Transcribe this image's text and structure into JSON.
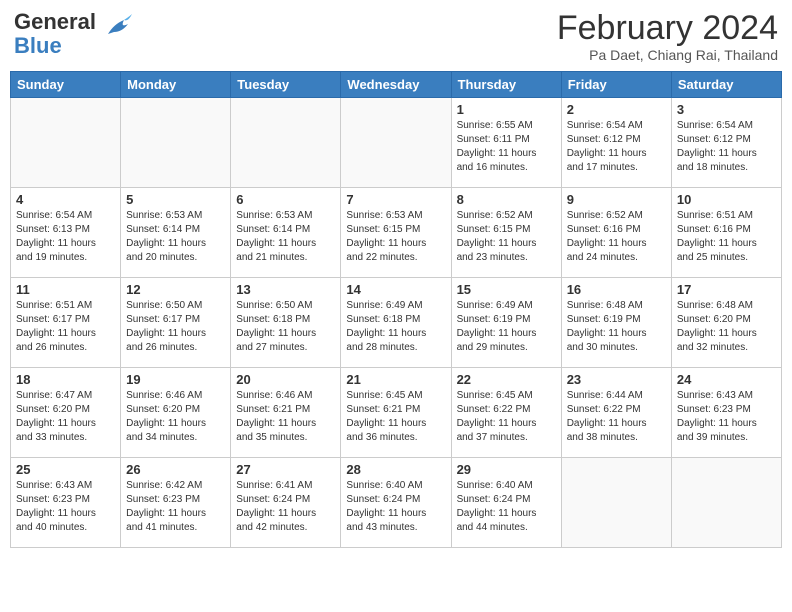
{
  "header": {
    "logo_line1": "General",
    "logo_line2": "Blue",
    "title": "February 2024",
    "subtitle": "Pa Daet, Chiang Rai, Thailand"
  },
  "days_of_week": [
    "Sunday",
    "Monday",
    "Tuesday",
    "Wednesday",
    "Thursday",
    "Friday",
    "Saturday"
  ],
  "weeks": [
    [
      {
        "day": "",
        "info": ""
      },
      {
        "day": "",
        "info": ""
      },
      {
        "day": "",
        "info": ""
      },
      {
        "day": "",
        "info": ""
      },
      {
        "day": "1",
        "info": "Sunrise: 6:55 AM\nSunset: 6:11 PM\nDaylight: 11 hours and 16 minutes."
      },
      {
        "day": "2",
        "info": "Sunrise: 6:54 AM\nSunset: 6:12 PM\nDaylight: 11 hours and 17 minutes."
      },
      {
        "day": "3",
        "info": "Sunrise: 6:54 AM\nSunset: 6:12 PM\nDaylight: 11 hours and 18 minutes."
      }
    ],
    [
      {
        "day": "4",
        "info": "Sunrise: 6:54 AM\nSunset: 6:13 PM\nDaylight: 11 hours and 19 minutes."
      },
      {
        "day": "5",
        "info": "Sunrise: 6:53 AM\nSunset: 6:14 PM\nDaylight: 11 hours and 20 minutes."
      },
      {
        "day": "6",
        "info": "Sunrise: 6:53 AM\nSunset: 6:14 PM\nDaylight: 11 hours and 21 minutes."
      },
      {
        "day": "7",
        "info": "Sunrise: 6:53 AM\nSunset: 6:15 PM\nDaylight: 11 hours and 22 minutes."
      },
      {
        "day": "8",
        "info": "Sunrise: 6:52 AM\nSunset: 6:15 PM\nDaylight: 11 hours and 23 minutes."
      },
      {
        "day": "9",
        "info": "Sunrise: 6:52 AM\nSunset: 6:16 PM\nDaylight: 11 hours and 24 minutes."
      },
      {
        "day": "10",
        "info": "Sunrise: 6:51 AM\nSunset: 6:16 PM\nDaylight: 11 hours and 25 minutes."
      }
    ],
    [
      {
        "day": "11",
        "info": "Sunrise: 6:51 AM\nSunset: 6:17 PM\nDaylight: 11 hours and 26 minutes."
      },
      {
        "day": "12",
        "info": "Sunrise: 6:50 AM\nSunset: 6:17 PM\nDaylight: 11 hours and 26 minutes."
      },
      {
        "day": "13",
        "info": "Sunrise: 6:50 AM\nSunset: 6:18 PM\nDaylight: 11 hours and 27 minutes."
      },
      {
        "day": "14",
        "info": "Sunrise: 6:49 AM\nSunset: 6:18 PM\nDaylight: 11 hours and 28 minutes."
      },
      {
        "day": "15",
        "info": "Sunrise: 6:49 AM\nSunset: 6:19 PM\nDaylight: 11 hours and 29 minutes."
      },
      {
        "day": "16",
        "info": "Sunrise: 6:48 AM\nSunset: 6:19 PM\nDaylight: 11 hours and 30 minutes."
      },
      {
        "day": "17",
        "info": "Sunrise: 6:48 AM\nSunset: 6:20 PM\nDaylight: 11 hours and 32 minutes."
      }
    ],
    [
      {
        "day": "18",
        "info": "Sunrise: 6:47 AM\nSunset: 6:20 PM\nDaylight: 11 hours and 33 minutes."
      },
      {
        "day": "19",
        "info": "Sunrise: 6:46 AM\nSunset: 6:20 PM\nDaylight: 11 hours and 34 minutes."
      },
      {
        "day": "20",
        "info": "Sunrise: 6:46 AM\nSunset: 6:21 PM\nDaylight: 11 hours and 35 minutes."
      },
      {
        "day": "21",
        "info": "Sunrise: 6:45 AM\nSunset: 6:21 PM\nDaylight: 11 hours and 36 minutes."
      },
      {
        "day": "22",
        "info": "Sunrise: 6:45 AM\nSunset: 6:22 PM\nDaylight: 11 hours and 37 minutes."
      },
      {
        "day": "23",
        "info": "Sunrise: 6:44 AM\nSunset: 6:22 PM\nDaylight: 11 hours and 38 minutes."
      },
      {
        "day": "24",
        "info": "Sunrise: 6:43 AM\nSunset: 6:23 PM\nDaylight: 11 hours and 39 minutes."
      }
    ],
    [
      {
        "day": "25",
        "info": "Sunrise: 6:43 AM\nSunset: 6:23 PM\nDaylight: 11 hours and 40 minutes."
      },
      {
        "day": "26",
        "info": "Sunrise: 6:42 AM\nSunset: 6:23 PM\nDaylight: 11 hours and 41 minutes."
      },
      {
        "day": "27",
        "info": "Sunrise: 6:41 AM\nSunset: 6:24 PM\nDaylight: 11 hours and 42 minutes."
      },
      {
        "day": "28",
        "info": "Sunrise: 6:40 AM\nSunset: 6:24 PM\nDaylight: 11 hours and 43 minutes."
      },
      {
        "day": "29",
        "info": "Sunrise: 6:40 AM\nSunset: 6:24 PM\nDaylight: 11 hours and 44 minutes."
      },
      {
        "day": "",
        "info": ""
      },
      {
        "day": "",
        "info": ""
      }
    ]
  ]
}
